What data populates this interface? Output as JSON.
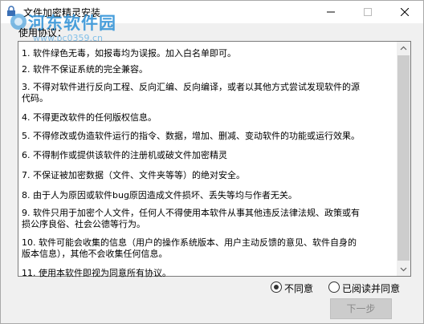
{
  "window": {
    "title": "文件加密精灵安装"
  },
  "watermark": {
    "text": "河东软件园",
    "sub": "www.pc0359.cn"
  },
  "agreement": {
    "group_label": "使用协议：",
    "lines": [
      "1. 软件绿色无毒，如报毒均为误报。加入白名单即可。",
      "2. 软件不保证系统的完全兼容。",
      "3. 不得对软件进行反向工程、反向汇编、反向编译，或者以其他方式尝试发现软件的源",
      "代码。",
      "4. 不得更改软件的任何版权信息。",
      "5. 不得修改或伪造软件运行的指令、数据，增加、删减、变动软件的功能或运行效果。",
      "6. 不得制作或提供该软件的注册机或破文件加密精灵",
      "7. 不保证被加密数据（文件、文件夹等等）的绝对安全。",
      "8. 由于人为原因或软件bug原因造成文件损坏、丢失等均与作者无关。",
      "9. 软件只用于加密个人文件，任何人不得使用本软件从事其他违反法律法规、政策或有",
      "损公序良俗、社会公德等行为。",
      "10. 软件可能会收集的信息（用户的操作系统版本、用户主动反馈的意见、软件自身的",
      "版本信息），其他不会收集任何信息。",
      "11. 使用本软件即视为同意所有协议。"
    ]
  },
  "options": {
    "disagree": "不同意",
    "agree": "已阅读并同意"
  },
  "buttons": {
    "next": "下一步"
  }
}
